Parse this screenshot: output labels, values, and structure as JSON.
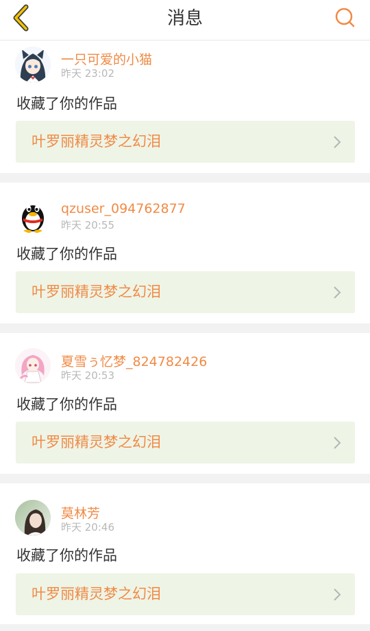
{
  "header": {
    "title": "消息",
    "back_icon": "chevron-left-icon",
    "search_icon": "search-icon",
    "accent_color": "#f2c200",
    "search_color": "#f08a45"
  },
  "messages": [
    {
      "username": "一只可爱的小猫",
      "time": "昨天 23:02",
      "action": "收藏了你的作品",
      "work_title": "叶罗丽精灵梦之幻泪",
      "avatar": "anime-girl-avatar"
    },
    {
      "username": "qzuser_094762877",
      "time": "昨天 20:55",
      "action": "收藏了你的作品",
      "work_title": "叶罗丽精灵梦之幻泪",
      "avatar": "qq-penguin-avatar"
    },
    {
      "username": "夏雪ぅ忆梦_824782426",
      "time": "昨天 20:53",
      "action": "收藏了你的作品",
      "work_title": "叶罗丽精灵梦之幻泪",
      "avatar": "pink-anime-avatar"
    },
    {
      "username": "莫林芳",
      "time": "昨天 20:46",
      "action": "收藏了你的作品",
      "work_title": "叶罗丽精灵梦之幻泪",
      "avatar": "photo-avatar"
    }
  ],
  "colors": {
    "username": "#f08a45",
    "time": "#b8b8b8",
    "link_background": "#eef4e6",
    "separator": "#f2f2f2"
  }
}
